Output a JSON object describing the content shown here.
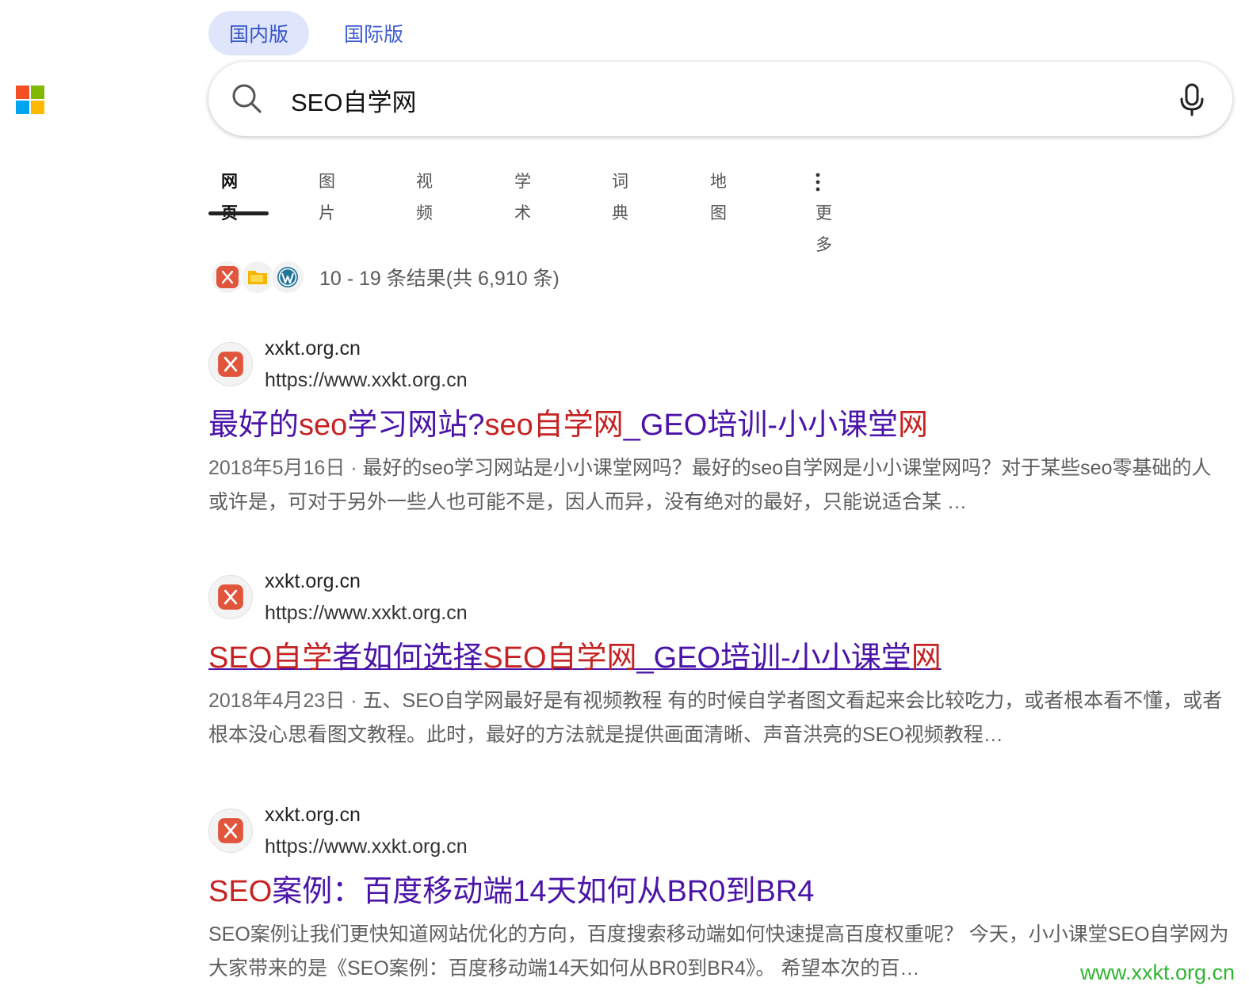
{
  "market_tabs": [
    {
      "label": "国内版",
      "active": true
    },
    {
      "label": "国际版",
      "active": false
    }
  ],
  "search": {
    "query": "SEO自学网"
  },
  "nav": [
    {
      "label": "网页",
      "active": true
    },
    {
      "label": "图片"
    },
    {
      "label": "视频"
    },
    {
      "label": "学术"
    },
    {
      "label": "词典"
    },
    {
      "label": "地图"
    },
    {
      "label": "更多"
    }
  ],
  "result_count": "10 - 19 条结果(共 6,910 条)",
  "results": [
    {
      "site_name": "xxkt.org.cn",
      "url": "https://www.xxkt.org.cn",
      "title_parts": [
        "最好的",
        "seo",
        "学习网站?",
        "seo自学网",
        "_GEO培训-小小课堂",
        "网"
      ],
      "date": "2018年5月16日 · ",
      "snippet": "最好的seo学习网站是小小课堂网吗？最好的seo自学网是小小课堂网吗？对于某些seo零基础的人或许是，可对于另外一些人也可能不是，因人而异，没有绝对的最好，只能说适合某 …"
    },
    {
      "site_name": "xxkt.org.cn",
      "url": "https://www.xxkt.org.cn",
      "title_parts": [
        "SEO自学",
        "者如何选择",
        "SEO自学网",
        "_GEO培训-小小课堂",
        "网"
      ],
      "date": "2018年4月23日 · ",
      "snippet": "五、SEO自学网最好是有视频教程 有的时候自学者图文看起来会比较吃力，或者根本看不懂，或者根本没心思看图文教程。此时，最好的方法就是提供画面清晰、声音洪亮的SEO视频教程…"
    },
    {
      "site_name": "xxkt.org.cn",
      "url": "https://www.xxkt.org.cn",
      "title_parts": [
        "SEO",
        "案例：百度移动端14天如何从BR0到BR4"
      ],
      "date": "",
      "snippet": "SEO案例让我们更快知道网站优化的方向，百度搜索移动端如何快速提高百度权重呢？ 今天，小小课堂SEO自学网为大家带来的是《SEO案例：百度移动端14天如何从BR0到BR4》。 希望本次的百…"
    }
  ],
  "watermark": "www.xxkt.org.cn",
  "colors": {
    "accent": "#3555c8",
    "title": "#4b14a8",
    "highlight": "#c62222",
    "favicon": "#e0553b"
  }
}
